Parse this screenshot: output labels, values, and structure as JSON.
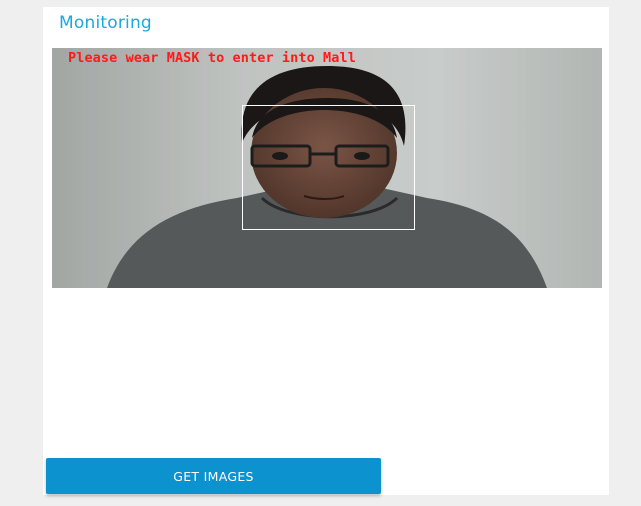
{
  "panel": {
    "title": "Monitoring"
  },
  "camera_feed": {
    "alert_text": "Please wear MASK to enter into Mall"
  },
  "actions": {
    "get_images_label": "GET IMAGES"
  },
  "colors": {
    "title": "#1ba7e0",
    "alert": "#ff1a1a",
    "button": "#0c92cf",
    "face_box": "#ffffff"
  }
}
